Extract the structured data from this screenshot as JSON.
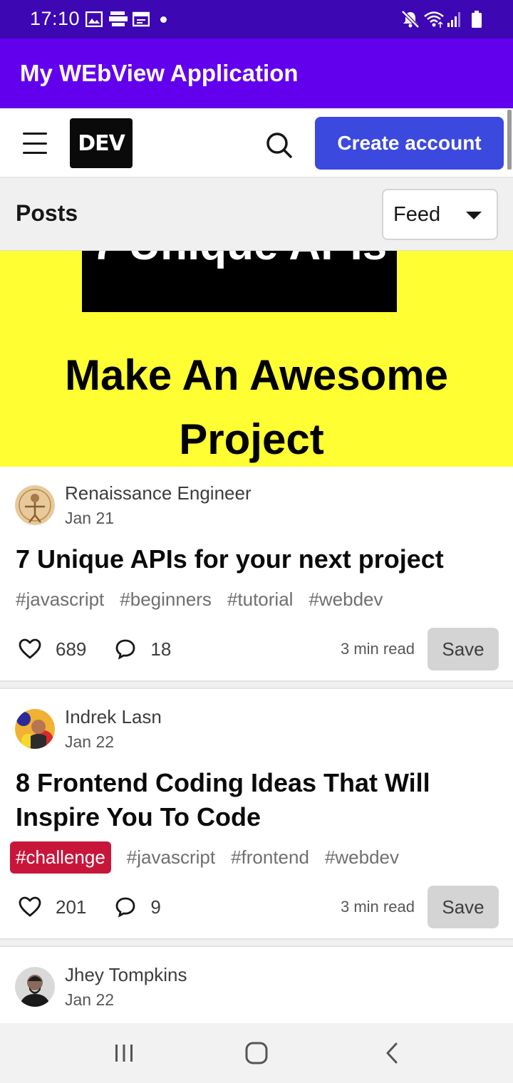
{
  "status_bar": {
    "time": "17:10",
    "left_icons": [
      "image-icon",
      "amazon-icon",
      "calendar-icon",
      "dot-icon"
    ],
    "right_icons": [
      "mute-icon",
      "wifi-icon",
      "signal-icon",
      "battery-icon"
    ]
  },
  "app_bar": {
    "title": "My WEbView Application"
  },
  "header": {
    "logo": "DEV",
    "create_account": "Create account"
  },
  "posts_bar": {
    "title": "Posts",
    "feed_selected": "Feed"
  },
  "cover": {
    "partial_title": "7 Unique APIs",
    "line1": "Make An Awesome",
    "line2": "Project",
    "bg_color": "#fefe33"
  },
  "posts": [
    {
      "author": "Renaissance Engineer",
      "date": "Jan 21",
      "title": "7 Unique APIs for your next project",
      "tags": [
        "#javascript",
        "#beginners",
        "#tutorial",
        "#webdev"
      ],
      "reactions": "689",
      "comments": "18",
      "read_time": "3 min read",
      "save": "Save"
    },
    {
      "author": "Indrek Lasn",
      "date": "Jan 22",
      "title": "8 Frontend Coding Ideas That Will Inspire You To Code",
      "tags": [
        "#challenge",
        "#javascript",
        "#frontend",
        "#webdev"
      ],
      "highlight_tag": "#challenge",
      "reactions": "201",
      "comments": "9",
      "read_time": "3 min read",
      "save": "Save"
    },
    {
      "author": "Jhey Tompkins",
      "date": "Jan 22"
    }
  ],
  "colors": {
    "status_bar": "#3d07b3",
    "app_bar": "#6200ee",
    "create_button": "#3b49df",
    "challenge_tag": "#c8163a"
  },
  "nav_bar": {
    "icons": [
      "recent-apps-icon",
      "home-icon",
      "back-icon"
    ]
  }
}
